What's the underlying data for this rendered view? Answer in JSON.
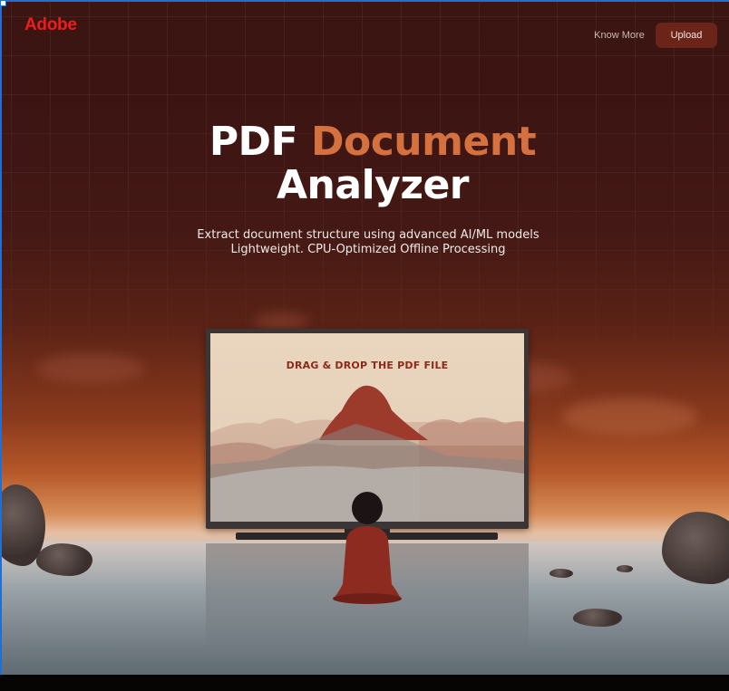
{
  "header": {
    "logo_text": "Adobe",
    "know_more_label": "Know More",
    "upload_label": "Upload"
  },
  "hero": {
    "title_part1": "PDF",
    "title_accent": "Document",
    "title_part2": "Analyzer",
    "subtitle_line1": "Extract document structure using advanced AI/ML models",
    "subtitle_line2": "Lightweight. CPU-Optimized Offline Processing"
  },
  "dropzone": {
    "label": "DRAG & DROP THE PDF FILE"
  },
  "colors": {
    "brand_red": "#ee1c1c",
    "accent_orange": "#d4713f",
    "upload_button": "#6b2418",
    "drop_label": "#8a2a18"
  }
}
